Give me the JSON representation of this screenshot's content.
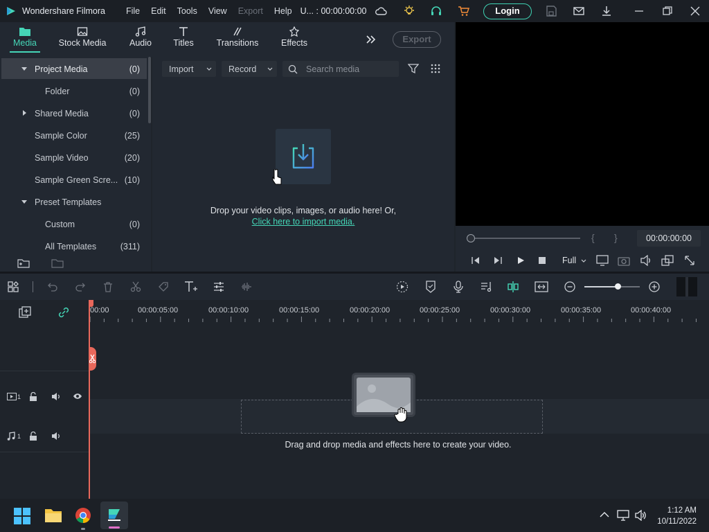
{
  "app": {
    "name": "Wondershare Filmora",
    "project": "U... : 00:00:00:00",
    "login_label": "Login"
  },
  "menus": [
    {
      "label": "File",
      "disabled": false
    },
    {
      "label": "Edit",
      "disabled": false
    },
    {
      "label": "Tools",
      "disabled": false
    },
    {
      "label": "View",
      "disabled": false
    },
    {
      "label": "Export",
      "disabled": true
    },
    {
      "label": "Help",
      "disabled": false
    }
  ],
  "tabs": [
    {
      "label": "Media",
      "icon": "folder-icon",
      "active": true
    },
    {
      "label": "Stock Media",
      "icon": "image-icon"
    },
    {
      "label": "Audio",
      "icon": "music-note-icon"
    },
    {
      "label": "Titles",
      "icon": "text-icon"
    },
    {
      "label": "Transitions",
      "icon": "transition-icon"
    },
    {
      "label": "Effects",
      "icon": "sparkle-icon"
    }
  ],
  "export_label": "Export",
  "sidebar": {
    "items": [
      {
        "label": "Project Media",
        "count": "(0)",
        "indent": 1,
        "expanded": true,
        "selected": true
      },
      {
        "label": "Folder",
        "count": "(0)",
        "indent": 2
      },
      {
        "label": "Shared Media",
        "count": "(0)",
        "indent": 1,
        "expanded": false
      },
      {
        "label": "Sample Color",
        "count": "(25)",
        "indent": 1
      },
      {
        "label": "Sample Video",
        "count": "(20)",
        "indent": 1
      },
      {
        "label": "Sample Green Scre...",
        "count": "(10)",
        "indent": 1
      },
      {
        "label": "Preset Templates",
        "count": "",
        "indent": 1,
        "expanded": true
      },
      {
        "label": "Custom",
        "count": "(0)",
        "indent": 2
      },
      {
        "label": "All Templates",
        "count": "(311)",
        "indent": 2
      }
    ]
  },
  "media": {
    "import_label": "Import",
    "record_label": "Record",
    "search_placeholder": "Search media",
    "drop_text": "Drop your video clips, images, or audio here! Or,",
    "import_link": "Click here to import media."
  },
  "preview": {
    "timecode": "00:00:00:00",
    "quality": "Full",
    "progress": 0
  },
  "timeline": {
    "ruler_labels": [
      "00:00",
      "00:00:05:00",
      "00:00:10:00",
      "00:00:15:00",
      "00:00:20:00",
      "00:00:25:00",
      "00:00:30:00",
      "00:00:35:00",
      "00:00:40:00"
    ],
    "video_track": "1",
    "audio_track": "1",
    "drop_text": "Drag and drop media and effects here to create your video.",
    "zoom_level": 0.6
  },
  "taskbar": {
    "time": "1:12 AM",
    "date": "10/11/2022"
  },
  "colors": {
    "accent": "#45d6b7",
    "playhead": "#e9685b",
    "panel": "#222831",
    "background": "#1f242b"
  }
}
